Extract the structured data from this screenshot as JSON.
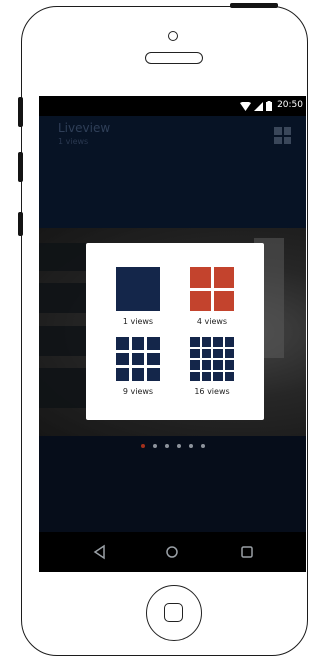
{
  "status_bar": {
    "time": "20:50",
    "icons": [
      "wifi-icon",
      "signal-icon",
      "battery-icon"
    ]
  },
  "app_bar": {
    "title": "Liveview",
    "subtitle": "1 views",
    "action_icon": "grid-icon"
  },
  "layout_picker": {
    "options": [
      {
        "label": "1 views",
        "icon": "single-view-icon",
        "color": "#14264a"
      },
      {
        "label": "4 views",
        "icon": "quad-view-icon",
        "color": "#c3432d",
        "selected": true
      },
      {
        "label": "9 views",
        "icon": "nine-view-icon",
        "color": "#14264a"
      },
      {
        "label": "16 views",
        "icon": "sixteen-view-icon",
        "color": "#14264a"
      }
    ]
  },
  "pager": {
    "count": 6,
    "active_index": 0,
    "active_color": "#a3301c"
  },
  "nav_bar": {
    "buttons": [
      "back-icon",
      "home-icon",
      "recents-icon"
    ]
  },
  "colors": {
    "accent": "#c3432d",
    "primary": "#14264a",
    "app_background": "#060d1a"
  }
}
